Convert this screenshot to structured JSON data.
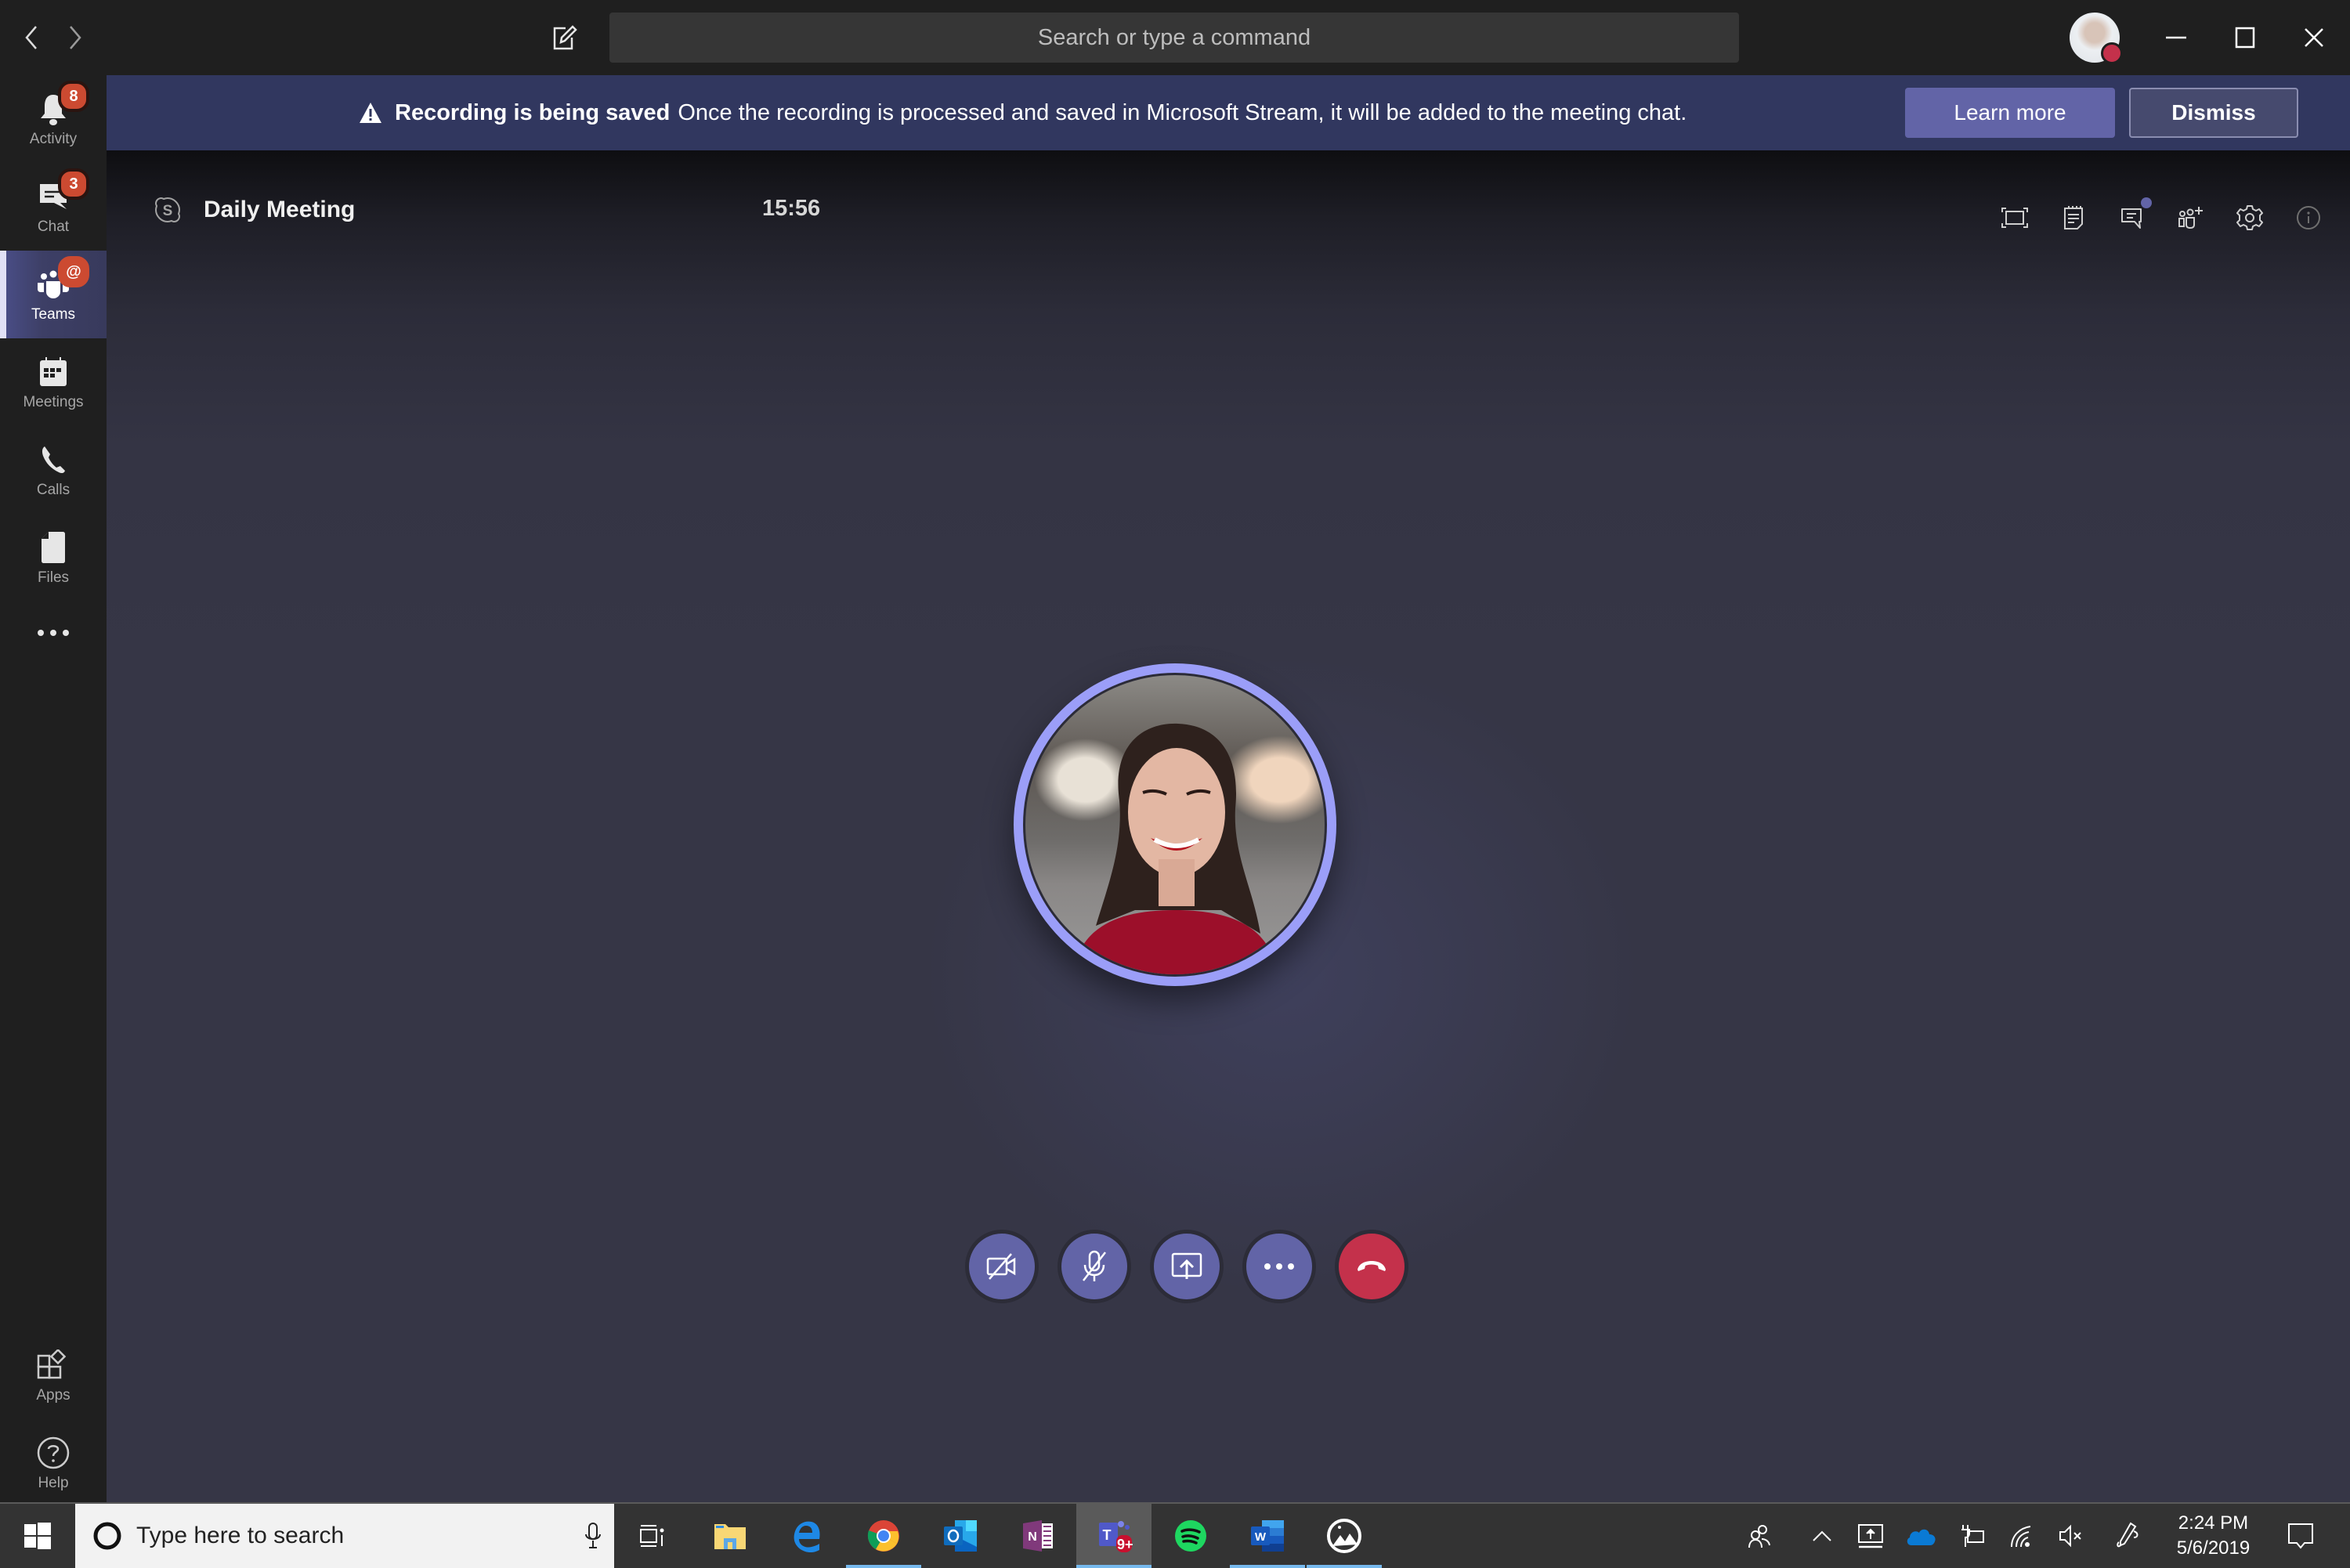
{
  "titlebar": {
    "back_icon": "chevron-left-icon",
    "forward_icon": "chevron-right-icon",
    "compose_icon": "compose-icon",
    "search_placeholder": "Search or type a command",
    "user_status_color": "#c4314b",
    "window_controls": [
      "minimize",
      "maximize",
      "close"
    ]
  },
  "sidebar": {
    "items": [
      {
        "label": "Activity",
        "icon": "bell-icon",
        "badge": "8"
      },
      {
        "label": "Chat",
        "icon": "chat-icon",
        "badge": "3"
      },
      {
        "label": "Teams",
        "icon": "teams-icon",
        "badge": "@",
        "active": true
      },
      {
        "label": "Meetings",
        "icon": "calendar-icon"
      },
      {
        "label": "Calls",
        "icon": "phone-icon"
      },
      {
        "label": "Files",
        "icon": "file-icon"
      },
      {
        "label": "More",
        "icon": "more-icon"
      }
    ],
    "bottom_items": [
      {
        "label": "Apps",
        "icon": "apps-icon"
      },
      {
        "label": "Help",
        "icon": "help-icon"
      }
    ]
  },
  "banner": {
    "title": "Recording is being saved",
    "message": "Once the recording is processed and saved in Microsoft Stream, it will be added to the meeting chat.",
    "learn_more": "Learn more",
    "dismiss": "Dismiss",
    "background": "#31375f"
  },
  "meeting": {
    "title": "Daily Meeting",
    "timer": "15:56",
    "header_icons": [
      "fullscreen-icon",
      "meeting-notes-icon",
      "conversation-icon",
      "add-people-icon",
      "settings-icon",
      "info-icon"
    ],
    "conversation_unread": true,
    "participant_ring_color": "#9b9ef8",
    "controls": [
      {
        "name": "camera-off",
        "label": "Turn camera on"
      },
      {
        "name": "mic-off",
        "label": "Unmute"
      },
      {
        "name": "share-screen",
        "label": "Share"
      },
      {
        "name": "more-actions",
        "label": "More actions"
      },
      {
        "name": "hang-up",
        "label": "Hang up"
      }
    ],
    "accent": "#6264a7",
    "hangup_color": "#c4314b"
  },
  "taskbar": {
    "search_placeholder": "Type here to search",
    "apps": [
      {
        "name": "Task View"
      },
      {
        "name": "File Explorer"
      },
      {
        "name": "Microsoft Edge"
      },
      {
        "name": "Google Chrome",
        "running": true
      },
      {
        "name": "Outlook"
      },
      {
        "name": "OneNote"
      },
      {
        "name": "Microsoft Teams",
        "running": true,
        "active": true,
        "badge": "9+"
      },
      {
        "name": "Spotify"
      },
      {
        "name": "Word",
        "running": true
      },
      {
        "name": "Photos",
        "running": true
      }
    ],
    "tray": [
      "people-icon",
      "chevron-up-icon",
      "projector-icon",
      "onedrive-icon",
      "battery-charging-icon",
      "wifi-icon",
      "volume-muted-icon",
      "pen-icon"
    ],
    "time": "2:24 PM",
    "date": "5/6/2019"
  }
}
